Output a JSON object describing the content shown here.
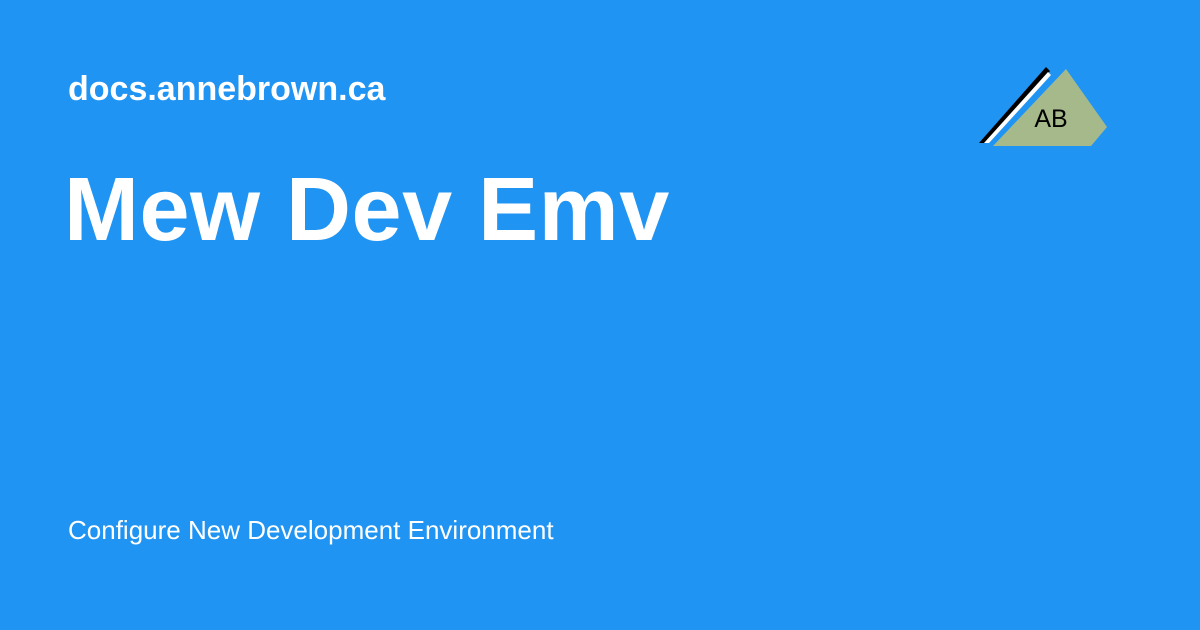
{
  "site": {
    "name": "docs.annebrown.ca"
  },
  "page": {
    "title": "Mew Dev Emv",
    "description": "Configure New Development Environment"
  },
  "logo": {
    "initials": "AB",
    "icon": "triangle-monogram-icon"
  },
  "colors": {
    "background": "#2094f3",
    "text": "#ffffff",
    "logo_fill": "#a6b98b",
    "logo_outline": "#000000",
    "logo_highlight": "#ffffff"
  }
}
